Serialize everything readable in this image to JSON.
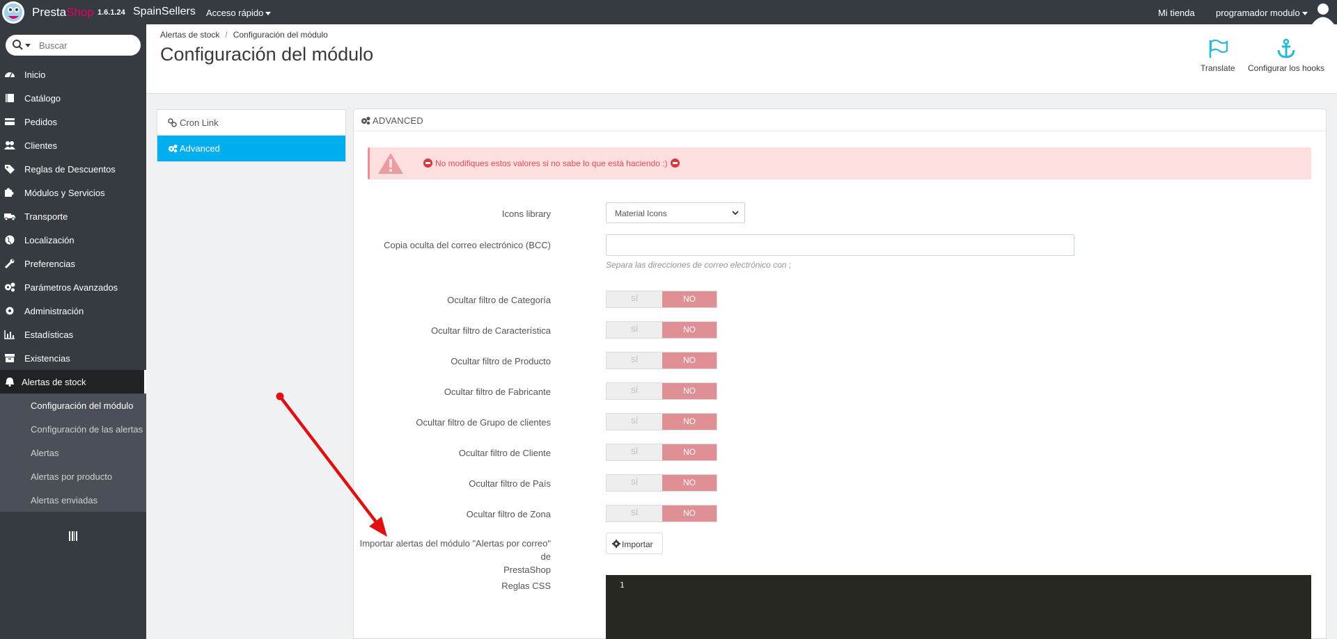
{
  "header": {
    "brand_main": "Presta",
    "brand_accent": "Shop",
    "version": "1.6.1.24",
    "store_name": "SpainSellers",
    "quick_access": "Acceso rápido",
    "my_store": "Mi tienda",
    "profile": "programador modulo"
  },
  "sidebar": {
    "search_placeholder": "Buscar",
    "items": [
      {
        "label": "Inicio",
        "icon": "dashboard-icon"
      },
      {
        "label": "Catálogo",
        "icon": "book-icon"
      },
      {
        "label": "Pedidos",
        "icon": "credit-card-icon"
      },
      {
        "label": "Clientes",
        "icon": "users-icon"
      },
      {
        "label": "Reglas de Descuentos",
        "icon": "tag-icon"
      },
      {
        "label": "Módulos y Servicios",
        "icon": "puzzle-icon"
      },
      {
        "label": "Transporte",
        "icon": "truck-icon"
      },
      {
        "label": "Localización",
        "icon": "globe-icon"
      },
      {
        "label": "Preferencias",
        "icon": "wrench-icon"
      },
      {
        "label": "Parámetros Avanzados",
        "icon": "cogs-icon"
      },
      {
        "label": "Administración",
        "icon": "gear-icon"
      },
      {
        "label": "Estadísticas",
        "icon": "bar-chart-icon"
      },
      {
        "label": "Existencias",
        "icon": "archive-icon"
      },
      {
        "label": "Alertas de stock",
        "icon": "bell-icon"
      }
    ],
    "sub_items": [
      "Configuración del módulo",
      "Configuración de las alertas",
      "Alertas",
      "Alertas por producto",
      "Alertas enviadas"
    ]
  },
  "page": {
    "breadcrumb_parent": "Alertas de stock",
    "breadcrumb_separator": "/",
    "breadcrumb_current": "Configuración del módulo",
    "title": "Configuración del módulo",
    "toolbar_translate": "Translate",
    "toolbar_hooks": "Configurar los hooks"
  },
  "tabs": [
    "Cron Link",
    "Advanced"
  ],
  "panel": {
    "title": "Advanced",
    "alert_text": "No modifiques estos valores si no sabe lo que está haciendo :)",
    "icons_library_label": "Icons library",
    "icons_library_value": "Material Icons",
    "bcc_label": "Copia oculta del correo electrónico (BCC)",
    "bcc_value": "",
    "bcc_help": "Separa las direcciones de correo electrónico con ;",
    "yes": "SÍ",
    "no": "NO",
    "switches": [
      "Ocultar filtro de Categoría",
      "Ocultar filtro de Característica",
      "Ocultar filtro de Producto",
      "Ocultar filtro de Fabricante",
      "Ocultar filtro de Grupo de clientes",
      "Ocultar filtro de Cliente",
      "Ocultar filtro de País",
      "Ocultar filtro de Zona"
    ],
    "import_label_1": "Importar alertas del módulo \"Alertas por correo\" de",
    "import_label_2": "PrestaShop",
    "import_button": "Importar",
    "css_label": "Reglas CSS",
    "code_line": "1"
  },
  "colors": {
    "topbar": "#363a41",
    "accent": "#00aff0",
    "brand_pink": "#df0067",
    "switch_no": "#e08f95",
    "alert_bg": "#fddfe0",
    "arrow": "#e01010"
  }
}
